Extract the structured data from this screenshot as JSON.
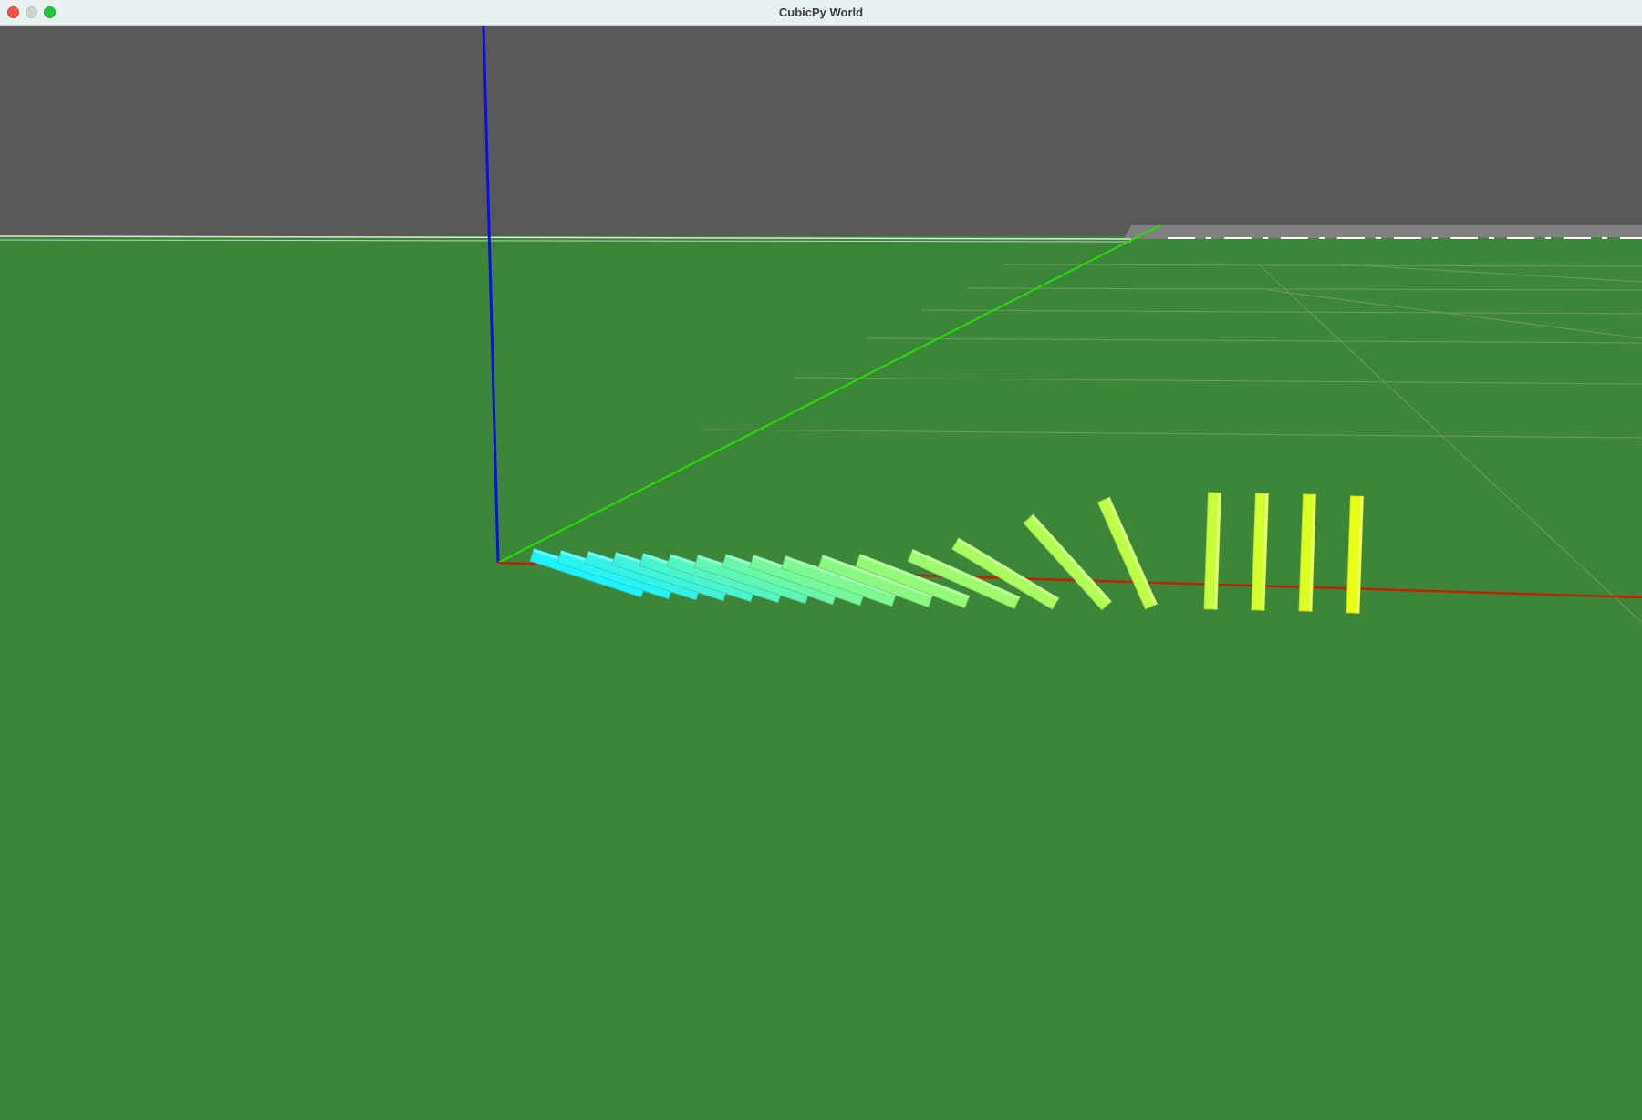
{
  "window": {
    "title": "CubicPy World"
  },
  "controls": {
    "close_icon": "close-circle",
    "minimize_icon": "minimize-circle",
    "zoom_icon": "zoom-circle"
  },
  "scene": {
    "sky_color": "#595959",
    "ground_color": "#3d8639",
    "axes": {
      "x_color": "#cc2200",
      "y_color": "#22dd00",
      "z_color": "#0000dd"
    },
    "dominoes": {
      "standing_count": 4,
      "fallen_color_start": "#1ff2ff",
      "fallen_color_end": "#e8ff16"
    }
  }
}
